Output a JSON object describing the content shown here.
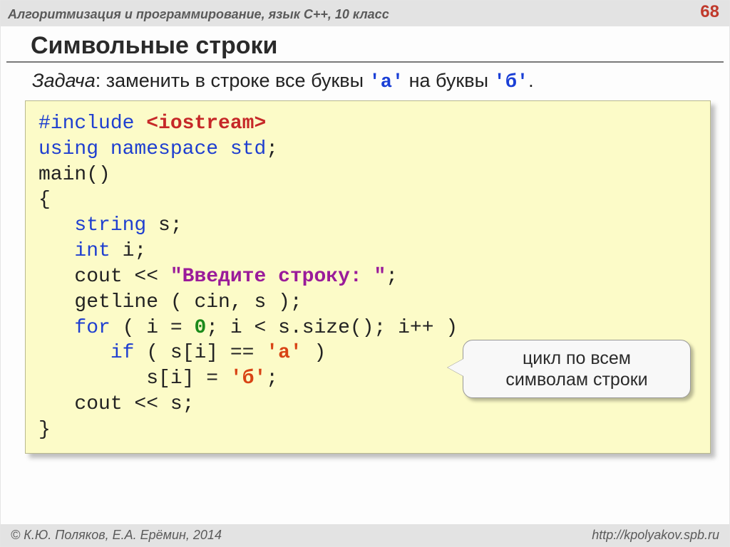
{
  "header": {
    "course": "Алгоритмизация и программирование, язык C++, 10 класс",
    "page": "68"
  },
  "title": "Символьные строки",
  "task": {
    "lead": "Задача",
    "sep": ": ",
    "body_before_a": "заменить в строке все буквы ",
    "a": "'а'",
    "body_mid": " на буквы ",
    "b": "'б'",
    "tail": "."
  },
  "code": {
    "l1_inc": "#include ",
    "l1_ang": "<iostream>",
    "l2_using": "using",
    "l2_ns": " namespace ",
    "l2_std": "std",
    "l2_end": ";",
    "l3": "main()",
    "l4": "{",
    "l5_pad": "   ",
    "l5_type": "string",
    "l5_rest": " s;",
    "l6_pad": "   ",
    "l6_type": "int",
    "l6_rest": " i;",
    "l7_pad": "   ",
    "l7_a": "cout << ",
    "l7_str": "\"Введите строку: \"",
    "l7_end": ";",
    "l8_pad": "   ",
    "l8": "getline ( cin, s );",
    "l9_pad": "   ",
    "l9_for": "for",
    "l9_a": " ( i = ",
    "l9_zero": "0",
    "l9_b": "; i < s.size(); i++ )",
    "l10_pad": "      ",
    "l10_if": "if",
    "l10_a": " ( s[i] == ",
    "l10_chr": "'а'",
    "l10_end": " )",
    "l11_pad": "         ",
    "l11_a": "s[i] = ",
    "l11_chr": "'б'",
    "l11_end": ";",
    "l12_pad": "   ",
    "l12": "cout << s;",
    "l13": "}"
  },
  "callout": {
    "line1": "цикл по всем",
    "line2": "символам строки"
  },
  "footer": {
    "copyright": "© К.Ю. Поляков, Е.А. Ерёмин, 2014",
    "url": "http://kpolyakov.spb.ru"
  }
}
